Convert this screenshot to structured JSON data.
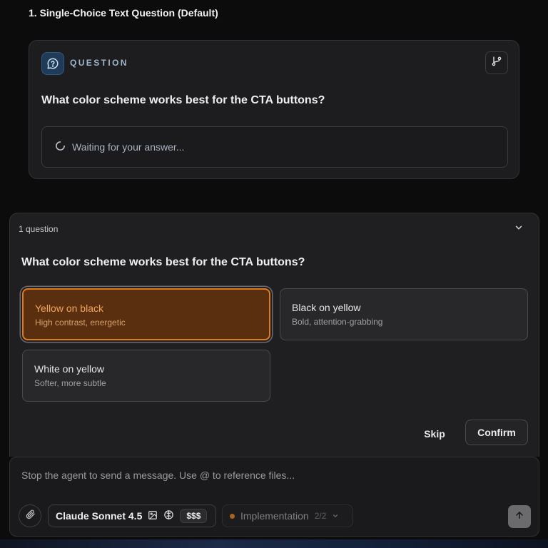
{
  "section": {
    "title": "1. Single-Choice Text Question (Default)"
  },
  "question_card": {
    "label": "QUESTION",
    "text": "What color scheme works best for the CTA buttons?",
    "waiting_text": "Waiting for your answer...",
    "icons": {
      "question": "question-bubble-icon",
      "branch": "git-branch-icon",
      "spinner": "loading-spinner-icon"
    }
  },
  "panel": {
    "count": "1 question",
    "question": "What color scheme works best for the CTA buttons?",
    "options": [
      {
        "title": "Yellow on black",
        "subtitle": "High contrast, energetic",
        "selected": true
      },
      {
        "title": "Black on yellow",
        "subtitle": "Bold, attention-grabbing",
        "selected": false
      },
      {
        "title": "White on yellow",
        "subtitle": "Softer, more subtle",
        "selected": false
      }
    ],
    "skip_label": "Skip",
    "confirm_label": "Confirm"
  },
  "composer": {
    "placeholder": "Stop the agent to send a message. Use @ to reference files...",
    "model": "Claude Sonnet 4.5",
    "cost": "$$$",
    "mode": "Implementation",
    "mode_count": "2/2"
  },
  "colors": {
    "accent_orange": "#e07a1c",
    "selected_bg": "#5a2f0f",
    "question_icon_bg": "#1f3b57"
  }
}
